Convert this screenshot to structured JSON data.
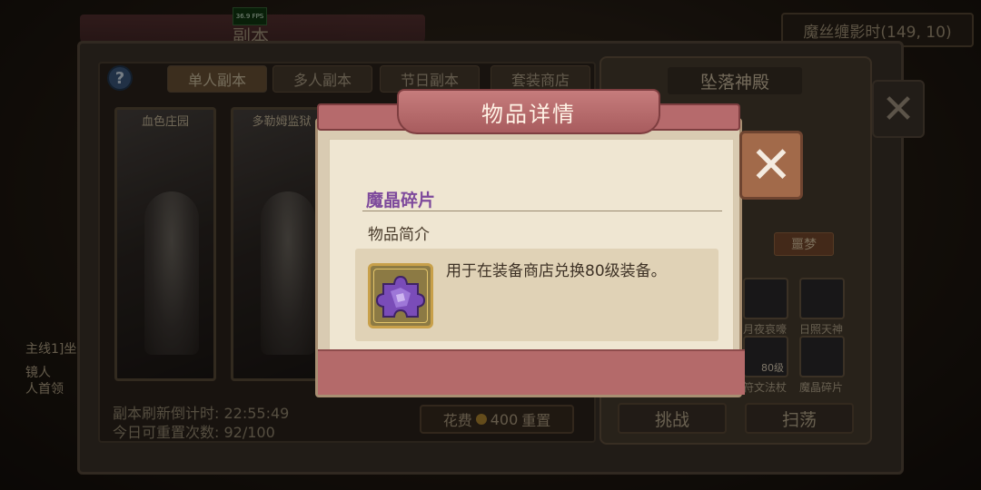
{
  "header": {
    "title": "副本",
    "fps": "36.9 FPS",
    "chain_label": "魔丝缠影时(149, 10)"
  },
  "tabs": [
    {
      "label": "单人副本",
      "active": true
    },
    {
      "label": "多人副本",
      "active": false
    },
    {
      "label": "节日副本",
      "active": false
    },
    {
      "label": "套装商店",
      "active": false
    }
  ],
  "help_label": "?",
  "dungeons": [
    {
      "label": "血色庄园"
    },
    {
      "label": "多勒姆监狱"
    }
  ],
  "footer": {
    "refresh_label": "副本刷新倒计时: 22:55:49",
    "reset_count_label": "今日可重置次数: 92/100",
    "reset_cost_prefix": "花费",
    "reset_cost": "400",
    "reset_label": "重置"
  },
  "right_panel": {
    "dungeon_title": "坠落神殿",
    "difficulty_selected": "噩梦",
    "rewards": [
      {
        "label": "月夜哀嚎",
        "count": ""
      },
      {
        "label": "日照天神",
        "count": ""
      },
      {
        "label": "符文法杖",
        "count": "80级"
      },
      {
        "label": "魔晶碎片",
        "count": ""
      }
    ],
    "challenge_label": "挑战",
    "sweep_label": "扫荡"
  },
  "left_side": {
    "line1": "主线1]坐",
    "line2": "镜人",
    "line3": "人首领"
  },
  "close_symbol": "✕",
  "modal": {
    "title": "物品详情",
    "item_name": "魔晶碎片",
    "section_label": "物品简介",
    "description": "用于在装备商店兑换80级装备。",
    "close_symbol": "✕"
  },
  "colors": {
    "item_name": "#7e4a9c",
    "banner": "#b66a6c",
    "footer": "#b46a6a"
  }
}
